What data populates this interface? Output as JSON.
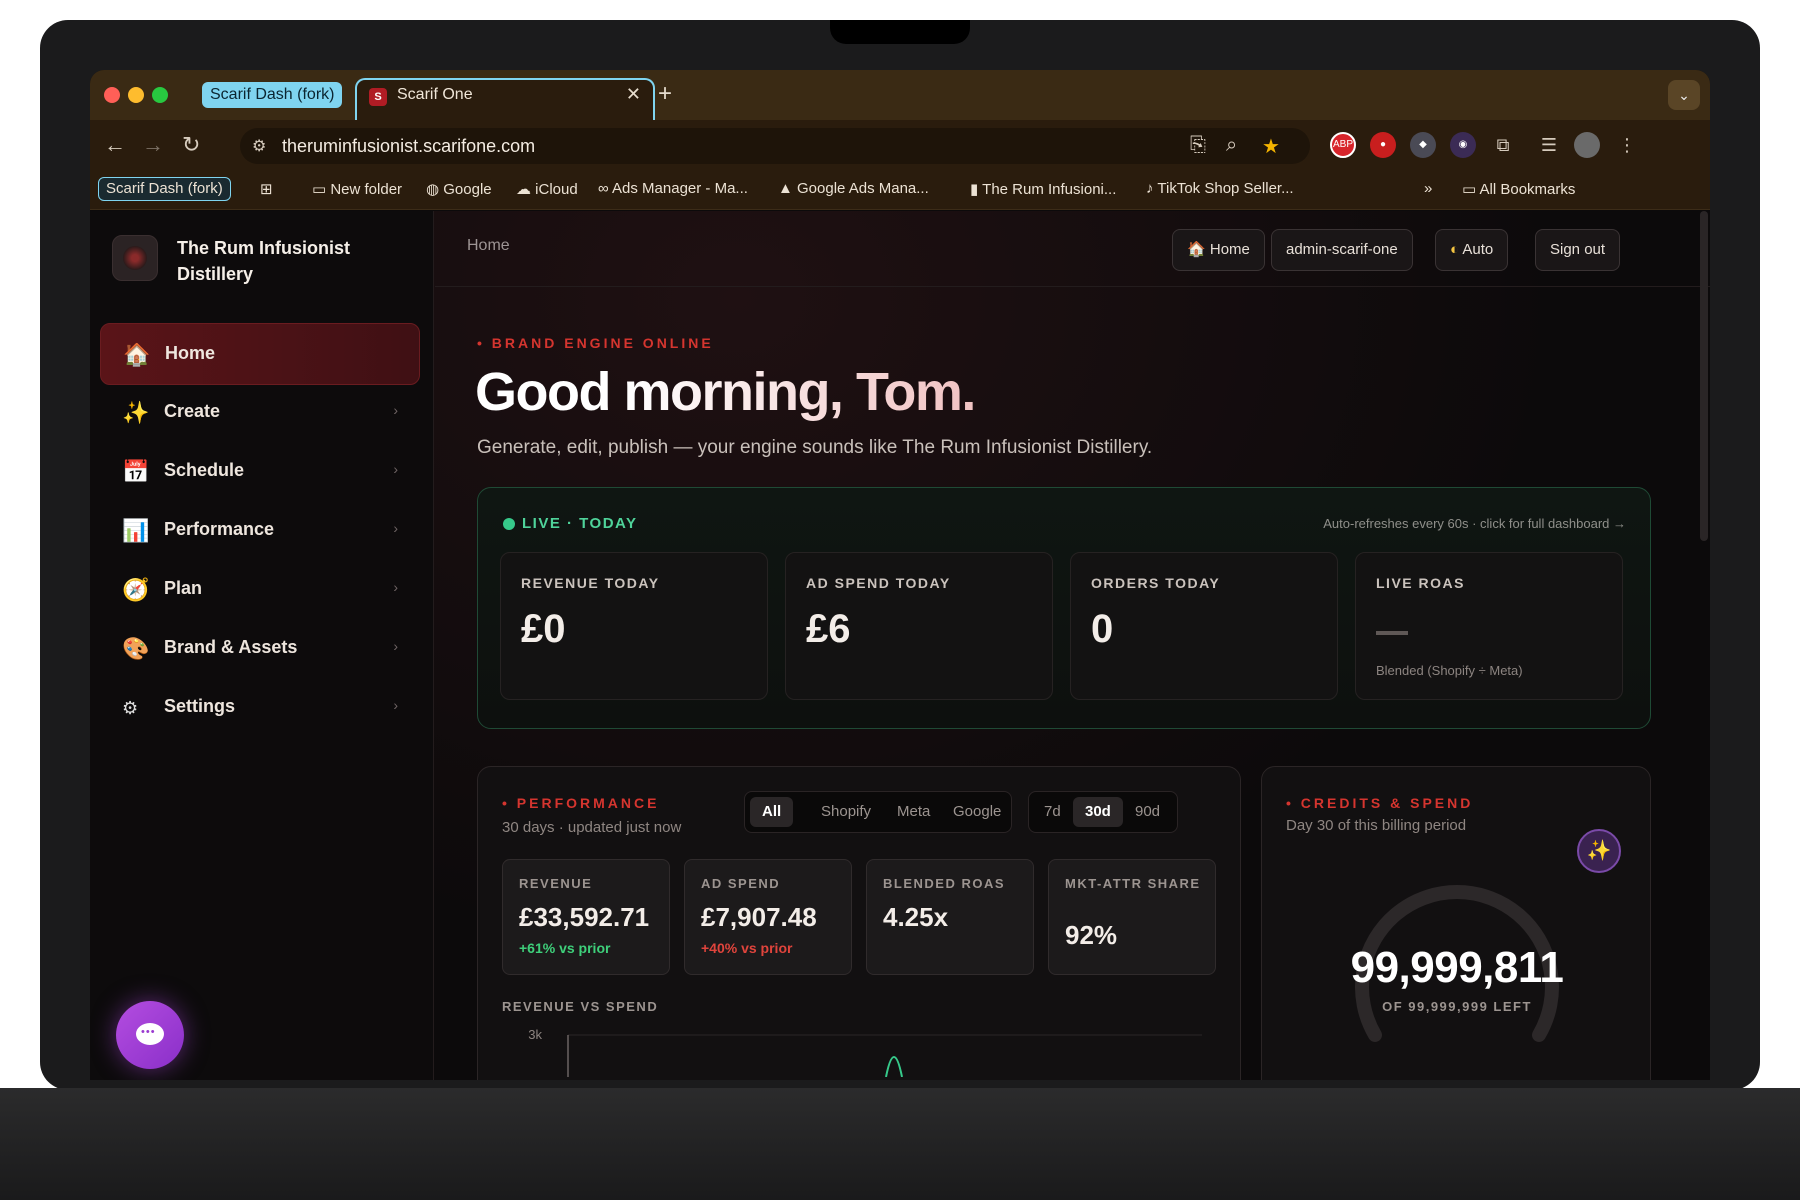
{
  "browser": {
    "tab_group_label": "Scarif Dash (fork)",
    "active_tab_title": "Scarif One",
    "active_tab_favicon": "S",
    "url": "theruminfusionist.scarifone.com",
    "bookmarks": [
      "New folder",
      "Google",
      "iCloud",
      "Ads Manager - Ma...",
      "Google Ads Mana...",
      "The Rum Infusioni...",
      "TikTok Shop Seller..."
    ],
    "bookmarks_group": "Scarif Dash (fork)",
    "all_bookmarks": "All Bookmarks",
    "ext_abp": "ABP"
  },
  "sidebar": {
    "brand_name": "The Rum Infusionist Distillery",
    "items": [
      {
        "label": "Home",
        "icon": "house-icon"
      },
      {
        "label": "Create",
        "icon": "sparkles-icon"
      },
      {
        "label": "Schedule",
        "icon": "calendar-icon"
      },
      {
        "label": "Performance",
        "icon": "bar-chart-icon"
      },
      {
        "label": "Plan",
        "icon": "compass-icon"
      },
      {
        "label": "Brand & Assets",
        "icon": "palette-icon"
      },
      {
        "label": "Settings",
        "icon": "gear-icon"
      }
    ]
  },
  "topbar": {
    "breadcrumb": "Home",
    "home_label": "Home",
    "user_label": "admin-scarif-one",
    "theme_label": "Auto",
    "signout_label": "Sign out"
  },
  "hero": {
    "eyebrow": "BRAND ENGINE ONLINE",
    "greeting": "Good morning, Tom.",
    "subtitle": "Generate, edit, publish — your engine sounds like The Rum Infusionist Distillery."
  },
  "live": {
    "title": "LIVE · TODAY",
    "note": "Auto-refreshes every 60s · click for full dashboard →",
    "kpis": [
      {
        "label": "REVENUE TODAY",
        "value": "£0"
      },
      {
        "label": "AD SPEND TODAY",
        "value": "£6"
      },
      {
        "label": "ORDERS TODAY",
        "value": "0"
      },
      {
        "label": "LIVE ROAS",
        "value": "",
        "note": "Blended (Shopify ÷ Meta)"
      }
    ]
  },
  "performance": {
    "eyebrow": "PERFORMANCE",
    "subtitle": "30 days · updated just now",
    "channels": [
      "All",
      "Shopify",
      "Meta",
      "Google"
    ],
    "active_channel": "All",
    "ranges": [
      "7d",
      "30d",
      "90d"
    ],
    "active_range": "30d",
    "metrics": [
      {
        "label": "REVENUE",
        "value": "£33,592.71",
        "delta": "+61% vs prior",
        "delta_color": "#3ecf7a"
      },
      {
        "label": "AD SPEND",
        "value": "£7,907.48",
        "delta": "+40% vs prior",
        "delta_color": "#e0443c"
      },
      {
        "label": "BLENDED ROAS",
        "value": "4.25x"
      },
      {
        "label": "MKT-ATTR SHARE",
        "value": "92%"
      }
    ],
    "chart_label": "REVENUE VS SPEND",
    "chart_y_tick": "3k"
  },
  "credits": {
    "eyebrow": "CREDITS & SPEND",
    "subtitle": "Day 30 of this billing period",
    "remaining": "99,999,811",
    "total_label": "OF 99,999,999 LEFT",
    "fraction_used": 1.9e-06
  },
  "colors": {
    "accent_red": "#d5352f",
    "live_green": "#4fd39a",
    "chat_purple": "#b44de0"
  }
}
